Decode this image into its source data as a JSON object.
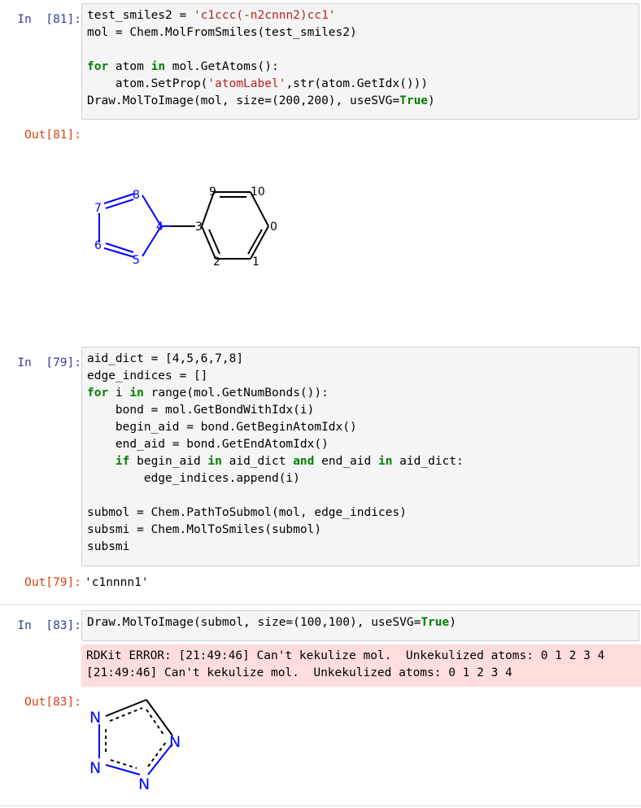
{
  "cells": [
    {
      "in_prompt": "In  [81]:",
      "out_prompt": "Out[81]:",
      "lines": [
        "test_smiles2 = 'c1ccc(-n2cnnn2)cc1'",
        "mol = Chem.MolFromSmiles(test_smiles2)",
        "",
        "for atom in mol.GetAtoms():",
        "    atom.SetProp('atomLabel',str(atom.GetIdx()))",
        "Draw.MolToImage(mol, size=(200,200), useSVG=True)"
      ],
      "molecule_labels": [
        "0",
        "1",
        "2",
        "3",
        "4",
        "5",
        "6",
        "7",
        "8",
        "9",
        "10"
      ]
    },
    {
      "in_prompt": "In  [79]:",
      "out_prompt": "Out[79]:",
      "lines": [
        "aid_dict = [4,5,6,7,8]",
        "edge_indices = []",
        "for i in range(mol.GetNumBonds()):",
        "    bond = mol.GetBondWithIdx(i)",
        "    begin_aid = bond.GetBeginAtomIdx()",
        "    end_aid = bond.GetEndAtomIdx()",
        "    if begin_aid in aid_dict and end_aid in aid_dict:",
        "        edge_indices.append(i)",
        "",
        "submol = Chem.PathToSubmol(mol, edge_indices)",
        "subsmi = Chem.MolToSmiles(submol)",
        "subsmi"
      ],
      "output": "'c1nnnn1'"
    },
    {
      "in_prompt": "In  [83]:",
      "out_prompt": "Out[83]:",
      "lines": [
        "Draw.MolToImage(submol, size=(100,100), useSVG=True)"
      ],
      "stderr": [
        "RDKit ERROR: [21:49:46] Can't kekulize mol.  Unkekulized atoms: 0 1 2 3 4",
        "[21:49:46] Can't kekulize mol.  Unkekulized atoms: 0 1 2 3 4"
      ],
      "molecule_labels": [
        "N",
        "N",
        "N",
        "N"
      ]
    }
  ],
  "colors": {
    "in_prompt": "#303f9f",
    "out_prompt": "#d84315",
    "keyword": "#008000",
    "string": "#ba2121",
    "error_bg": "#ffdddd",
    "atom_n": "#0000ff"
  }
}
